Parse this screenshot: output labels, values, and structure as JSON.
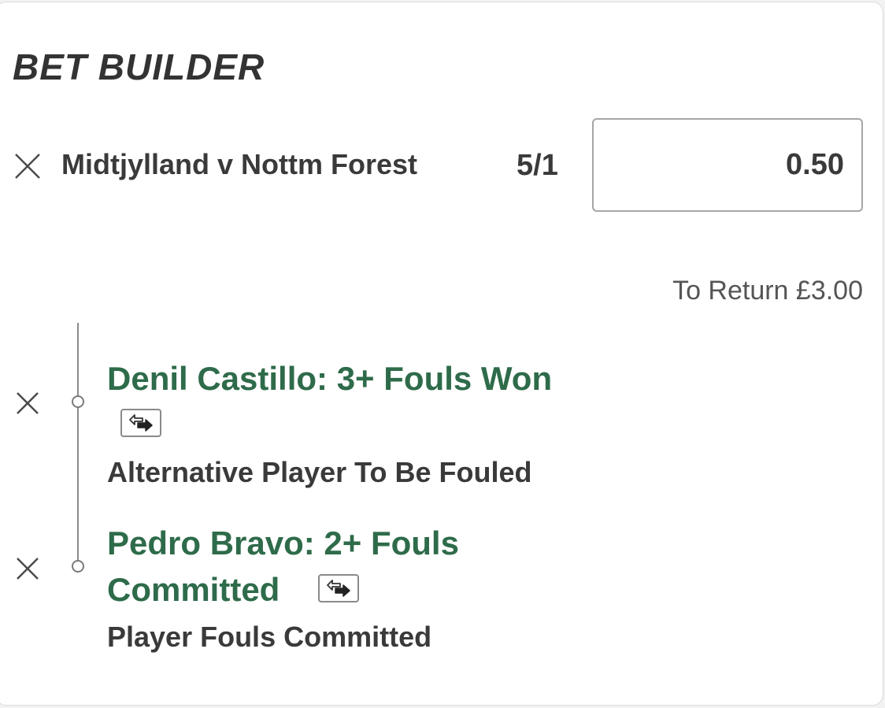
{
  "header": {
    "title": "BET BUILDER"
  },
  "bet": {
    "match": "Midtjylland v Nottm Forest",
    "odds": "5/1",
    "stake": "0.50",
    "to_return": "To Return £3.00"
  },
  "selections": [
    {
      "name": "Denil Castillo: 3+ Fouls Won",
      "market": "Alternative Player To Be Fouled",
      "icon": "swap-icon"
    },
    {
      "name_line1": "Pedro Bravo: 2+ Fouls",
      "name_line2": "Committed",
      "market": "Player Fouls Committed",
      "icon": "swap-icon"
    }
  ],
  "colors": {
    "selection_text": "#2e6b4a",
    "text": "#3a3a3a"
  }
}
